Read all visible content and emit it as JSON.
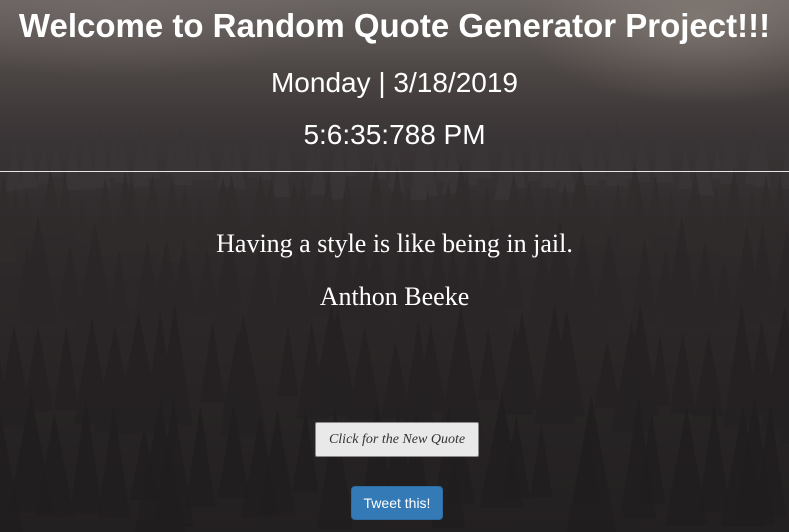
{
  "header": {
    "title": "Welcome to Random Quote Generator Project!!!",
    "date": "Monday | 3/18/2019",
    "time": "5:6:35:788 PM"
  },
  "quote": {
    "text": "Having a style is like being in jail.",
    "author": "Anthon Beeke"
  },
  "buttons": {
    "new_quote_label": "Click for the New Quote",
    "tweet_label": "Tweet this!"
  },
  "colors": {
    "text": "#ffffff",
    "tweet_button": "#337ab7",
    "new_quote_button": "#e9e9e9",
    "background_dark": "#2a2627"
  }
}
